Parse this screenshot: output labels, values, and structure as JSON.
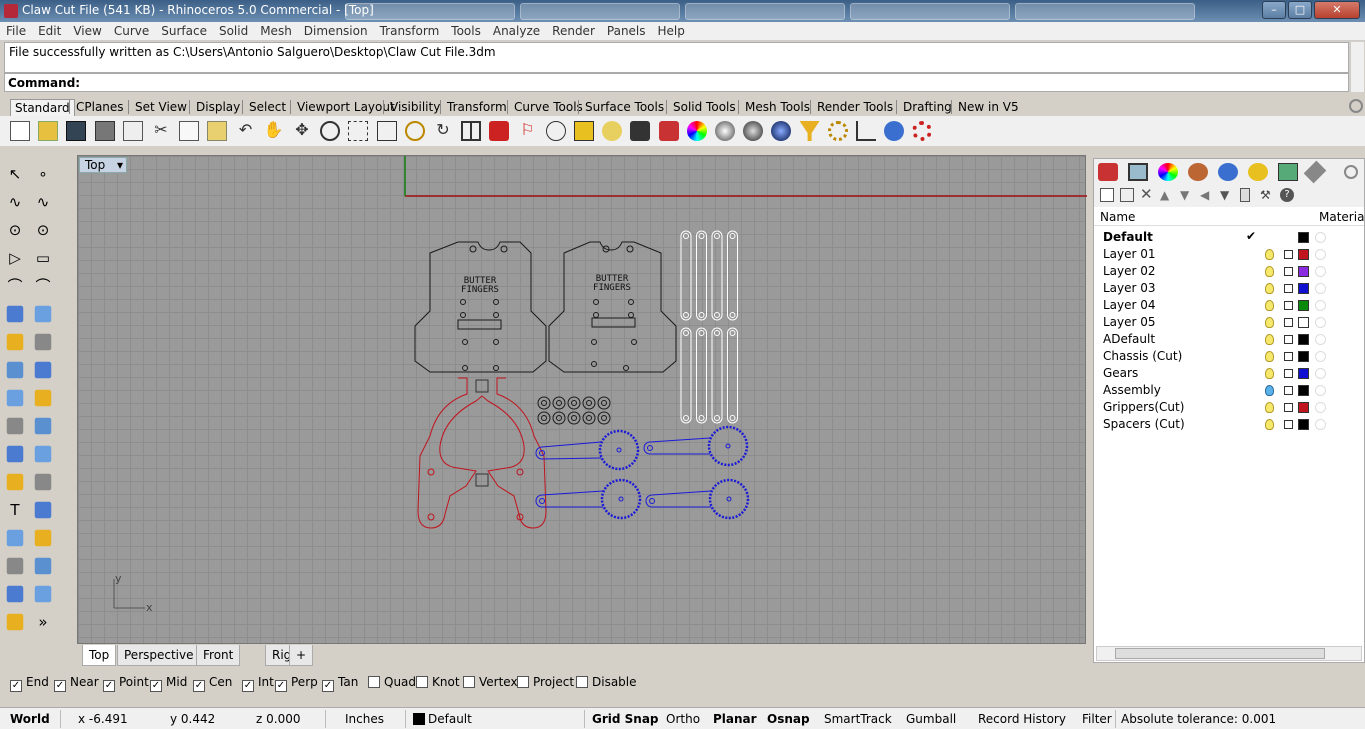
{
  "window": {
    "title": "Claw Cut File (541 KB) - Rhinoceros 5.0 Commercial - [Top]",
    "min_label": "–",
    "max_label": "□",
    "close_label": "✕"
  },
  "menu": [
    "File",
    "Edit",
    "View",
    "Curve",
    "Surface",
    "Solid",
    "Mesh",
    "Dimension",
    "Transform",
    "Tools",
    "Analyze",
    "Render",
    "Panels",
    "Help"
  ],
  "history": {
    "text": "File successfully written as C:\\Users\\Antonio Salguero\\Desktop\\Claw Cut File.3dm"
  },
  "command": {
    "label": "Command:",
    "value": ""
  },
  "toolbar_tabs": [
    "Standard",
    "CPlanes",
    "Set View",
    "Display",
    "Select",
    "Viewport Layout",
    "Visibility",
    "Transform",
    "Curve Tools",
    "Surface Tools",
    "Solid Tools",
    "Mesh Tools",
    "Render Tools",
    "Drafting",
    "New in V5"
  ],
  "toolbar_icons": [
    "new-icon",
    "open-icon",
    "save-icon",
    "print-icon",
    "import-icon",
    "cut-icon",
    "copy-icon",
    "paste-icon",
    "undo-icon",
    "pan-icon",
    "rotate-view-icon",
    "zoom-icon",
    "zoom-window-icon",
    "zoom-extents-icon",
    "zoom-selected-icon",
    "rotate-icon",
    "four-view-icon",
    "car-icon",
    "named-cplane-icon",
    "cplane-icon",
    "gumball-icon",
    "light-icon",
    "lock-icon",
    "layer-icon",
    "color-wheel-icon",
    "shaded-sphere-icon",
    "rendered-sphere-icon",
    "blue-sphere-icon",
    "filter-icon",
    "settings-gears-icon",
    "point-edit-icon",
    "help-icon",
    "options-gear-icon"
  ],
  "viewport": {
    "label": "Top",
    "axis_x": "x",
    "axis_y": "y",
    "logo_text_1": "BUTTER",
    "logo_text_2": "FINGERS"
  },
  "viewport_tabs": [
    "Top",
    "Perspective",
    "Front",
    "Right"
  ],
  "layers": {
    "header_name": "Name",
    "header_material": "Material",
    "rows": [
      {
        "name": "Default",
        "color": "#000000",
        "current": true,
        "check": "✔"
      },
      {
        "name": "Layer 01",
        "color": "#c0141e"
      },
      {
        "name": "Layer 02",
        "color": "#8a2be2"
      },
      {
        "name": "Layer 03",
        "color": "#1010d0"
      },
      {
        "name": "Layer 04",
        "color": "#0a8a0a"
      },
      {
        "name": "Layer 05",
        "color": "#ffffff"
      },
      {
        "name": "ADefault",
        "color": "#000000"
      },
      {
        "name": "Chassis (Cut)",
        "color": "#000000"
      },
      {
        "name": "Gears",
        "color": "#1010d0"
      },
      {
        "name": "Assembly",
        "color": "#000000",
        "bulb_blue": true
      },
      {
        "name": "Grippers(Cut)",
        "color": "#c0141e"
      },
      {
        "name": "Spacers (Cut)",
        "color": "#000000"
      }
    ]
  },
  "osnaps": [
    {
      "label": "End",
      "checked": true
    },
    {
      "label": "Near",
      "checked": true
    },
    {
      "label": "Point",
      "checked": true
    },
    {
      "label": "Mid",
      "checked": true
    },
    {
      "label": "Cen",
      "checked": true
    },
    {
      "label": "Int",
      "checked": true
    },
    {
      "label": "Perp",
      "checked": true
    },
    {
      "label": "Tan",
      "checked": true
    },
    {
      "label": "Quad",
      "checked": false
    },
    {
      "label": "Knot",
      "checked": false
    },
    {
      "label": "Vertex",
      "checked": false
    },
    {
      "label": "Project",
      "checked": false
    },
    {
      "label": "Disable",
      "checked": false
    }
  ],
  "status": {
    "cplane": "World",
    "x": "x -6.491",
    "y": "y 0.442",
    "z": "z 0.000",
    "units": "Inches",
    "layer": "Default",
    "grid_snap": "Grid Snap",
    "ortho": "Ortho",
    "planar": "Planar",
    "osnap": "Osnap",
    "smarttrack": "SmartTrack",
    "gumball": "Gumball",
    "record_history": "Record History",
    "filter": "Filter",
    "tolerance": "Absolute tolerance: 0.001"
  },
  "colors": {
    "gripper": "#c0141e",
    "gears": "#1a1ad8",
    "chassis": "#1a1a1a",
    "spacers": "#ffffff",
    "x_axis": "#a01010",
    "y_axis": "#108010"
  }
}
